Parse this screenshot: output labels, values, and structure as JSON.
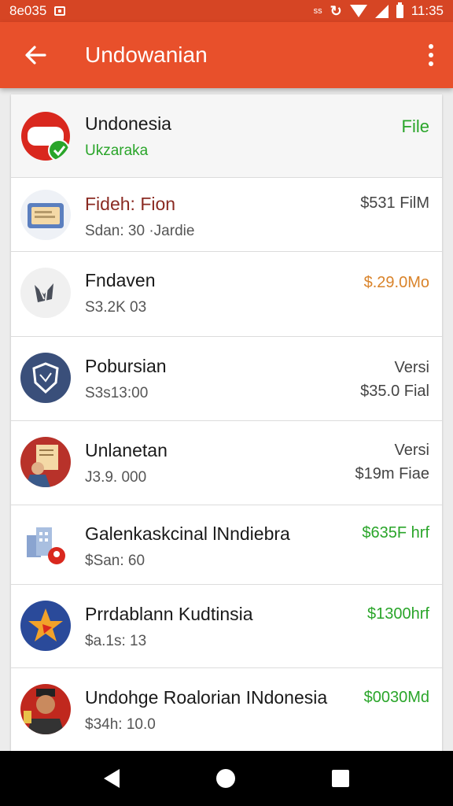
{
  "status_bar": {
    "left_text": "8e035",
    "small_text": "ss",
    "time": "11:35"
  },
  "app_bar": {
    "title": "Undowanian"
  },
  "rows": [
    {
      "title": "Undonesia",
      "subtitle": "Ukzaraka",
      "right_1": "",
      "right_2": "File",
      "icon": "flag-badge-icon"
    },
    {
      "title": "Fideh: Fion",
      "subtitle": "Sdan: 30 ·Jardie",
      "right_1": "",
      "right_2": "$531 FilM",
      "icon": "document-icon"
    },
    {
      "title": "Fndaven",
      "subtitle": "S3.2K 03",
      "right_1": "",
      "right_2": "$.29.0Mo",
      "icon": "emblem-icon"
    },
    {
      "title": "Pobursian",
      "subtitle": "S3s13:00",
      "right_1": "Versi",
      "right_2": "$35.0 Fial",
      "icon": "shield-icon"
    },
    {
      "title": "Unlanetan",
      "subtitle": "J3.9. 000",
      "right_1": "Versi",
      "right_2": "$19m Fiae",
      "icon": "person-document-icon"
    },
    {
      "title": "Galenkaskcinal lNndiebra",
      "subtitle": "$San: 60",
      "right_1": "",
      "right_2": "$635F hrf",
      "icon": "building-pin-icon"
    },
    {
      "title": "Prrdablann Kudtinsia",
      "subtitle": "$a.1ѕ: 13",
      "right_1": "",
      "right_2": "$1300hrf",
      "icon": "star-icon"
    },
    {
      "title": "Undohge Roalorian INdonesia",
      "subtitle": "$34h: 10.0",
      "right_1": "",
      "right_2": "$0030Md",
      "icon": "avatar-icon"
    }
  ],
  "colors": {
    "app_bar": "#e8502b",
    "status_bar": "#d64524",
    "green": "#2aa52a",
    "orange": "#d9832a"
  }
}
